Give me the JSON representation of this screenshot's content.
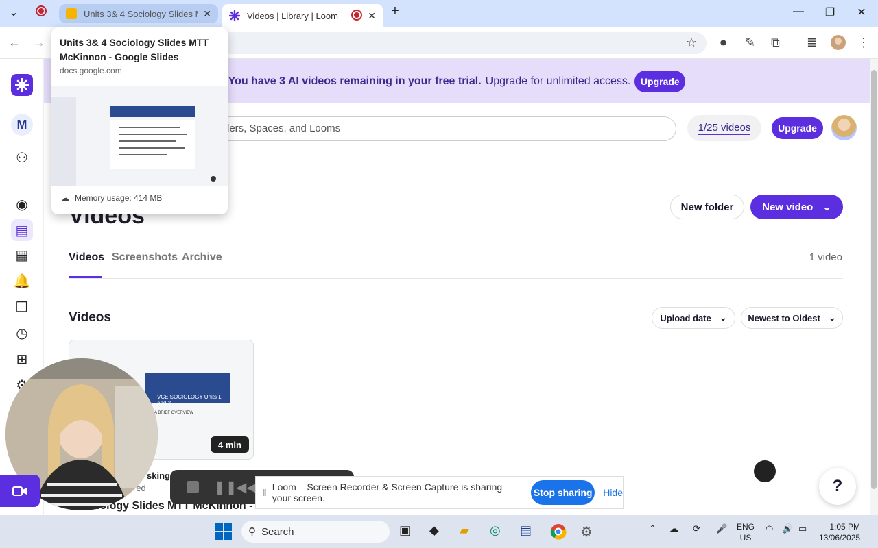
{
  "browser": {
    "tabs": [
      {
        "title": "Units 3& 4 Sociology Slides MTT McKinnon - Google Slides",
        "short": "Units 3& 4 Sociology Slides M"
      },
      {
        "title": "Videos | Library | Loom"
      }
    ],
    "tooltip": {
      "title": "Units 3& 4 Sociology Slides MTT McKinnon - Google Slides",
      "url": "docs.google.com",
      "memory": "Memory usage: 414 MB"
    }
  },
  "loom": {
    "workspace_initial": "M",
    "banner": {
      "bold": "You have 3 AI videos remaining in your free trial.",
      "rest": "Upgrade for unlimited access.",
      "button": "Upgrade"
    },
    "search_placeholder": "lers, Spaces, and Looms",
    "video_count": "1/25 videos",
    "header_upgrade": "Upgrade",
    "page_title": "Videos",
    "new_folder": "New folder",
    "new_video": "New video",
    "tabs": [
      "Videos",
      "Screenshots",
      "Archive"
    ],
    "count": "1 video",
    "section_title": "Videos",
    "sort_by": "Upload date",
    "sort_order": "Newest to Oldest",
    "card": {
      "duration": "4 min",
      "slide_title": "VCE SOCIOLOGY Units 1 and 2",
      "slide_sub": "A BRIEF OVERVIEW",
      "title_fragment": "sking",
      "sub_fragment": "red",
      "name_fragment": "ciology Slides MTT McKinnon -"
    },
    "share_bar": {
      "message": "Loom – Screen Recorder & Screen Capture is sharing your screen.",
      "stop": "Stop sharing",
      "hide": "Hide"
    },
    "help": "?"
  },
  "taskbar": {
    "search": "Search",
    "lang1": "ENG",
    "lang2": "US",
    "time": "1:05 PM",
    "date": "13/06/2025"
  }
}
